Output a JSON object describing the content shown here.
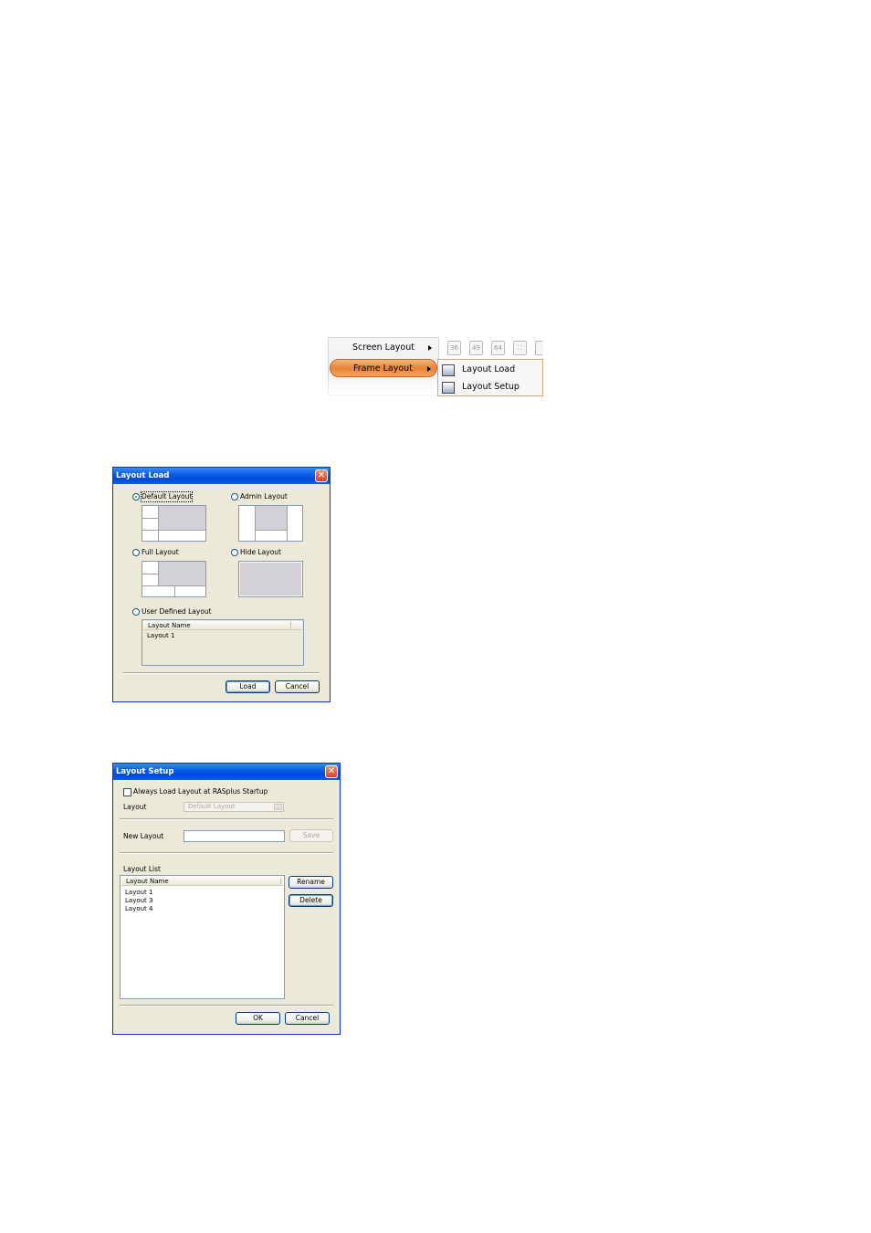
{
  "menu": {
    "items": [
      {
        "label": "Screen Layout"
      },
      {
        "label": "Frame Layout"
      }
    ],
    "toolbar_icons": [
      "36",
      "49",
      "64",
      "fullscreen-icon",
      "more-icon"
    ],
    "submenu": [
      {
        "label": "Layout Load",
        "icon": "layout-load-icon"
      },
      {
        "label": "Layout Setup",
        "icon": "layout-setup-icon"
      }
    ]
  },
  "layout_load": {
    "title": "Layout Load",
    "options": {
      "default": "Default Layout",
      "admin": "Admin Layout",
      "full": "Full Layout",
      "hide": "Hide Layout",
      "user_defined": "User Defined Layout"
    },
    "selected": "Default Layout",
    "list": {
      "header": "Layout Name",
      "rows": [
        "Layout 1"
      ]
    },
    "buttons": {
      "load": "Load",
      "cancel": "Cancel"
    }
  },
  "layout_setup": {
    "title": "Layout Setup",
    "always_load_label": "Always Load Layout at RASplus Startup",
    "always_load_checked": false,
    "layout_label": "Layout",
    "layout_value": "Default Layout",
    "new_layout_label": "New Layout",
    "new_layout_value": "",
    "save_label": "Save",
    "list_label": "Layout List",
    "list": {
      "header": "Layout Name",
      "rows": [
        "Layout 1",
        "Layout 3",
        "Layout 4"
      ]
    },
    "buttons": {
      "rename": "Rename",
      "delete": "Delete",
      "ok": "OK",
      "cancel": "Cancel"
    }
  },
  "colors": {
    "titlebar": "#0a5ee8",
    "dialog_bg": "#ece9d8",
    "menu_highlight": "#e6843a"
  }
}
